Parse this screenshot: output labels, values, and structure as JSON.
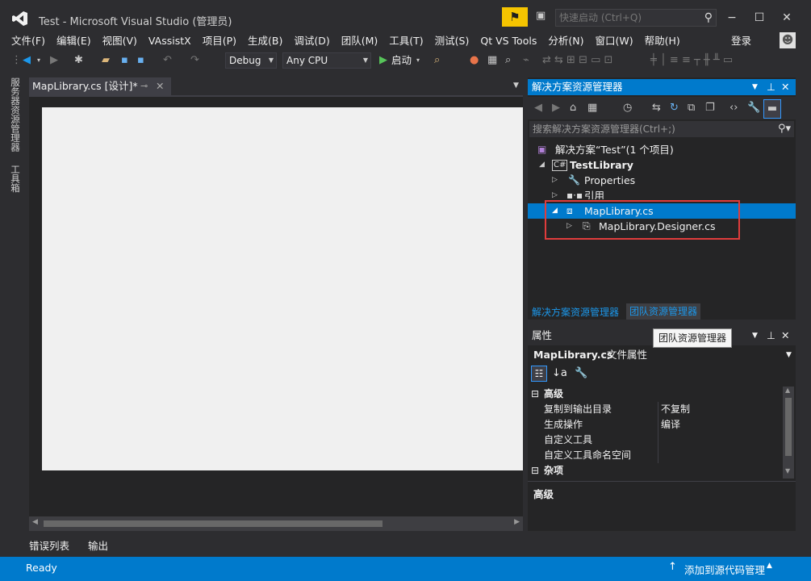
{
  "window": {
    "title": "Test - Microsoft Visual Studio (管理员)"
  },
  "quick_launch": {
    "placeholder": "快速启动 (Ctrl+Q)"
  },
  "menu": [
    "文件(F)",
    "编辑(E)",
    "视图(V)",
    "VAssistX",
    "项目(P)",
    "生成(B)",
    "调试(D)",
    "团队(M)",
    "工具(T)",
    "测试(S)",
    "Qt VS Tools",
    "分析(N)",
    "窗口(W)",
    "帮助(H)"
  ],
  "login_label": "登录",
  "toolbar": {
    "config": "Debug",
    "platform": "Any CPU",
    "start_label": "启动"
  },
  "left_strip": {
    "server_explorer": "服务器资源管理器",
    "toolbox": "工具箱"
  },
  "doc_tab": {
    "label": "MapLibrary.cs [设计]*"
  },
  "bottom_tabs": [
    "错误列表 ...",
    "输出"
  ],
  "status": {
    "left": "Ready",
    "right": "添加到源代码管理"
  },
  "solution_explorer": {
    "title": "解决方案资源管理器",
    "search_placeholder": "搜索解决方案资源管理器(Ctrl+;)",
    "tree": {
      "solution": "解决方案“Test”(1 个项目)",
      "project": "TestLibrary",
      "properties": "Properties",
      "references": "引用",
      "file": "MapLibrary.cs",
      "designer": "MapLibrary.Designer.cs"
    },
    "tabs": [
      "解决方案资源管理器",
      "团队资源管理器"
    ]
  },
  "tooltip": "团队资源管理器",
  "properties": {
    "title": "属性",
    "object": "MapLibrary.cs",
    "object_type": "文件属性",
    "categories": {
      "advanced": "高级",
      "misc": "杂项"
    },
    "rows": [
      {
        "name": "复制到输出目录",
        "value": "不复制"
      },
      {
        "name": "生成操作",
        "value": "编译"
      },
      {
        "name": "自定义工具",
        "value": ""
      },
      {
        "name": "自定义工具命名空间",
        "value": ""
      }
    ],
    "description_title": "高级"
  },
  "colors": {
    "accent": "#007acc",
    "highlight_box": "#e03c3c",
    "notification": "#f5c400"
  }
}
